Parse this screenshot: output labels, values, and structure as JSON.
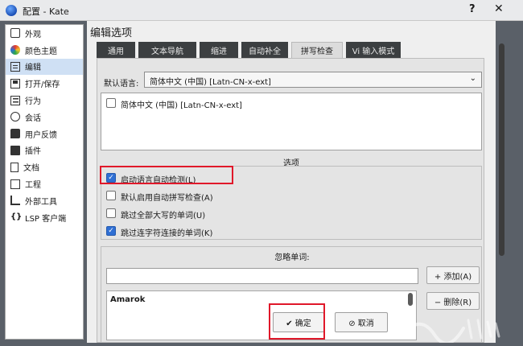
{
  "window": {
    "title": "配置 - Kate",
    "help_glyph": "?",
    "close_glyph": "✕"
  },
  "sidebar": {
    "items": [
      {
        "label": "外观",
        "icon": "appearance-icon"
      },
      {
        "label": "颜色主题",
        "icon": "color-theme-icon"
      },
      {
        "label": "编辑",
        "icon": "edit-icon",
        "active": true
      },
      {
        "label": "打开/保存",
        "icon": "open-save-icon"
      },
      {
        "label": "行为",
        "icon": "behavior-icon"
      },
      {
        "label": "会话",
        "icon": "session-icon"
      },
      {
        "label": "用户反馈",
        "icon": "user-feedback-icon"
      },
      {
        "label": "插件",
        "icon": "plugin-icon"
      },
      {
        "label": "文档",
        "icon": "document-icon"
      },
      {
        "label": "工程",
        "icon": "project-icon"
      },
      {
        "label": "外部工具",
        "icon": "external-tools-icon"
      },
      {
        "label": "LSP 客户端",
        "icon": "lsp-client-icon"
      }
    ]
  },
  "main": {
    "title": "编辑选项",
    "tabs": [
      {
        "label": "通用"
      },
      {
        "label": "文本导航"
      },
      {
        "label": "缩进"
      },
      {
        "label": "自动补全"
      },
      {
        "label": "拼写检查",
        "active": true
      },
      {
        "label": "Vi 输入模式"
      }
    ]
  },
  "spellcheck": {
    "default_language_label": "默认语言:",
    "default_language_value": "简体中文 (中国) [Latn-CN-x-ext]",
    "language_list": [
      {
        "label": "简体中文 (中国) [Latn-CN-x-ext]",
        "checked": false
      }
    ],
    "options_title": "选项",
    "options": [
      {
        "label": "启动语言自动检测(L)",
        "checked": true
      },
      {
        "label": "默认启用自动拼写检查(A)",
        "checked": false
      },
      {
        "label": "跳过全部大写的单词(U)",
        "checked": false
      },
      {
        "label": "跳过连字符连接的单词(K)",
        "checked": true
      }
    ],
    "ignored_title": "忽略单词:",
    "ignored_input_value": "",
    "add_label": "+ 添加(A)",
    "remove_label": "− 删除(R)",
    "ignored_words": [
      "Amarok"
    ]
  },
  "footer": {
    "ok_label": "✔ 确定",
    "cancel_label": "⊘ 取消"
  },
  "colors": {
    "accent": "#2f6fd4",
    "highlight": "#e0182a",
    "dark_tab": "#3c3f41"
  }
}
